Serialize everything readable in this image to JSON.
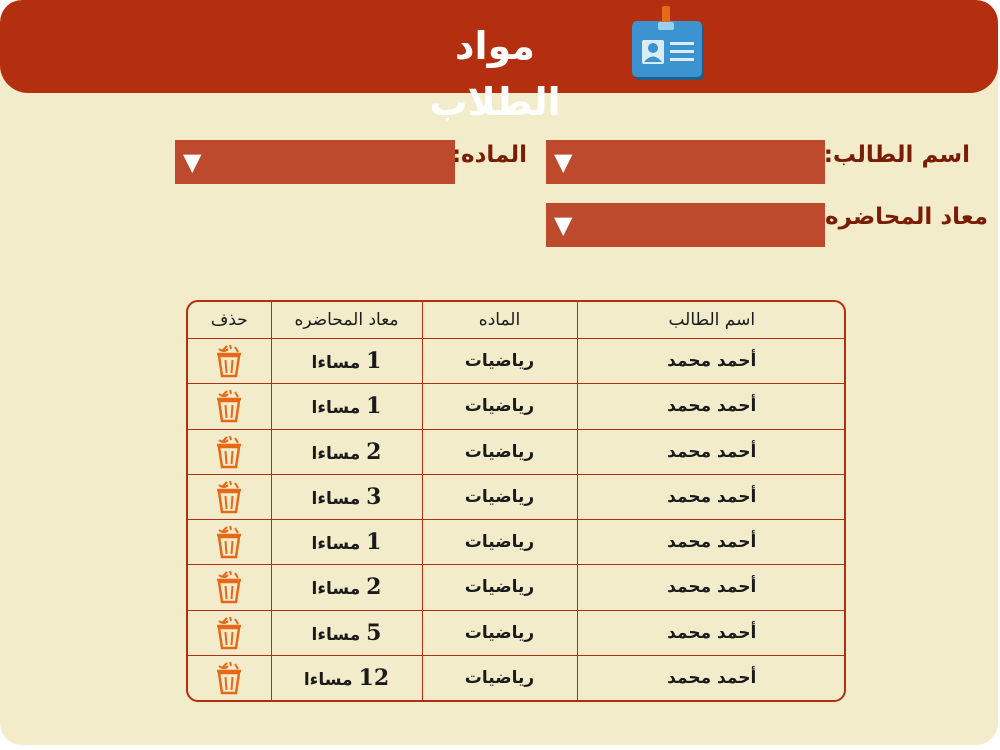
{
  "header": {
    "title": "مواد الطلاب",
    "icon": "id-card-icon"
  },
  "form": {
    "student_label": "اسم الطالب:",
    "subject_label": "الماده:",
    "lecture_time_label": "معاد المحاضره:",
    "dropdown_arrow": "▼"
  },
  "table": {
    "headers": [
      "اسم الطالب",
      "الماده",
      "معاد المحاضره",
      "حذف"
    ],
    "time_suffix": "مساءا",
    "rows": [
      {
        "student": "أحمد محمد",
        "subject": "رياضيات",
        "hour": "1"
      },
      {
        "student": "أحمد محمد",
        "subject": "رياضيات",
        "hour": "1"
      },
      {
        "student": "أحمد محمد",
        "subject": "رياضيات",
        "hour": "2"
      },
      {
        "student": "أحمد محمد",
        "subject": "رياضيات",
        "hour": "3"
      },
      {
        "student": "أحمد محمد",
        "subject": "رياضيات",
        "hour": "1"
      },
      {
        "student": "أحمد محمد",
        "subject": "رياضيات",
        "hour": "2"
      },
      {
        "student": "أحمد محمد",
        "subject": "رياضيات",
        "hour": "5"
      },
      {
        "student": "أحمد محمد",
        "subject": "رياضيات",
        "hour": "12"
      }
    ],
    "delete_icon": "trash-icon"
  },
  "colors": {
    "header_bg": "#b42e10",
    "panel_bg": "#f3ecca",
    "select_bg": "#bd4a2c",
    "label_text": "#7a1d06",
    "delete_icon": "#e8681a"
  }
}
